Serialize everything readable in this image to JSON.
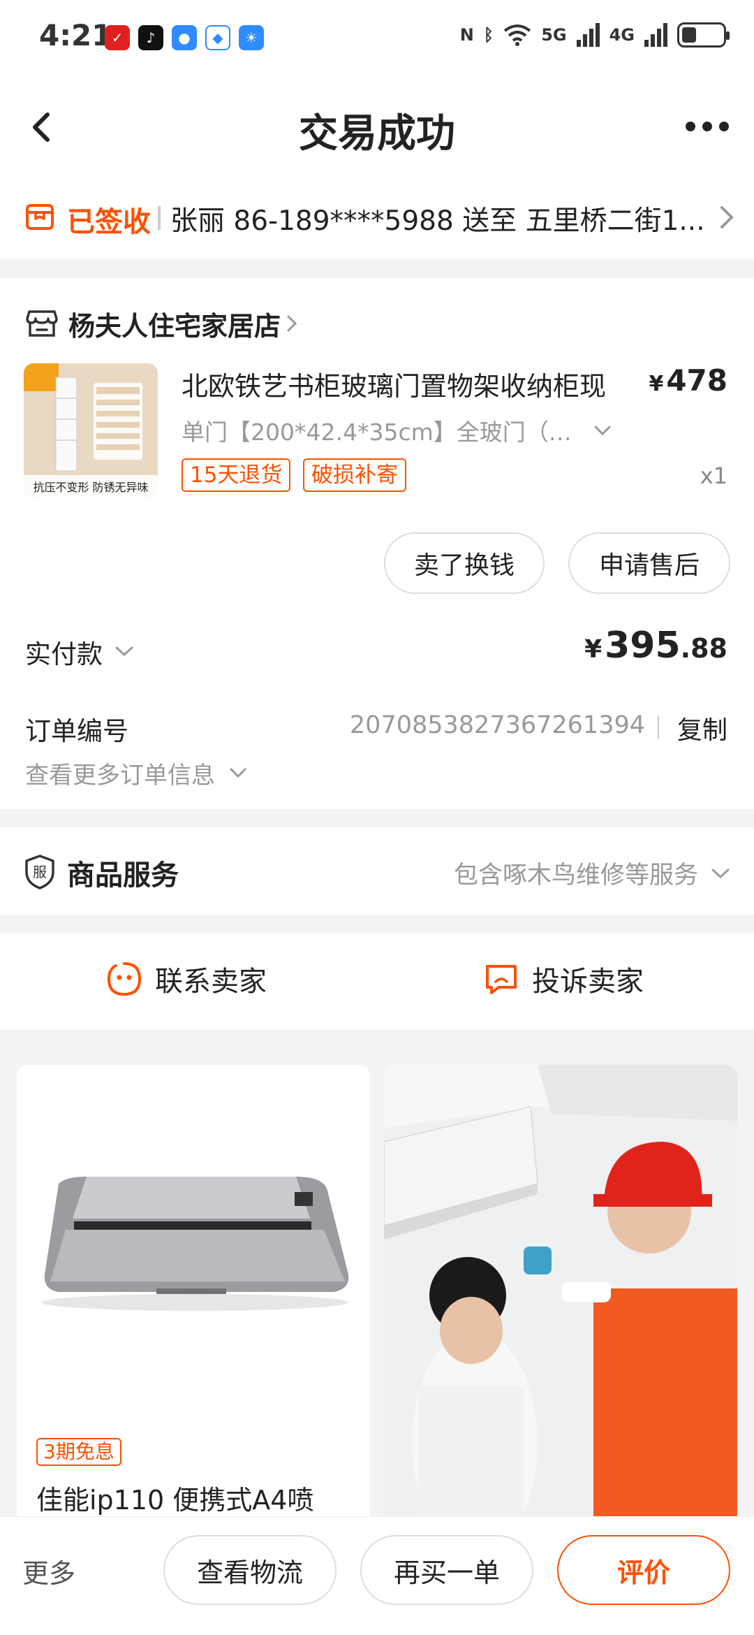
{
  "status_bar": {
    "time": "4:21",
    "network": "5G",
    "network2": "4G"
  },
  "header": {
    "title": "交易成功"
  },
  "delivery": {
    "status": "已签收",
    "info": "张丽  86-189****5988  送至  五里桥二街1..."
  },
  "shop": {
    "name": "杨夫人住宅家居店"
  },
  "product": {
    "title": "北欧铁艺书柜玻璃门置物架收纳柜现",
    "price_symbol": "¥",
    "price": "478",
    "spec": "单门【200*42.4*35cm】全玻门（白...",
    "tags": [
      "15天退货",
      "破损补寄"
    ],
    "quantity": "x1",
    "thumb_caption": "抗压不变形  防锈无异味"
  },
  "actions": {
    "sell_label": "卖了换钱",
    "after_sale_label": "申请售后"
  },
  "payment": {
    "label": "实付款",
    "symbol": "¥",
    "amount_int": "395",
    "amount_dec": ".88"
  },
  "order": {
    "number_label": "订单编号",
    "number": "2070853827367261394",
    "copy_label": "复制",
    "more_info_label": "查看更多订单信息"
  },
  "services": {
    "title": "商品服务",
    "description": "包含啄木鸟维修等服务"
  },
  "contact": {
    "contact_label": "联系卖家",
    "complain_label": "投诉卖家"
  },
  "feed": {
    "item1": {
      "badge": "3期免息",
      "title": "佳能ip110 便携式A4喷"
    }
  },
  "bottom_bar": {
    "more_label": "更多",
    "logistics_label": "查看物流",
    "rebuy_label": "再买一单",
    "review_label": "评价"
  },
  "colors": {
    "accent": "#ff5000",
    "text": "#222222",
    "muted": "#999999"
  }
}
